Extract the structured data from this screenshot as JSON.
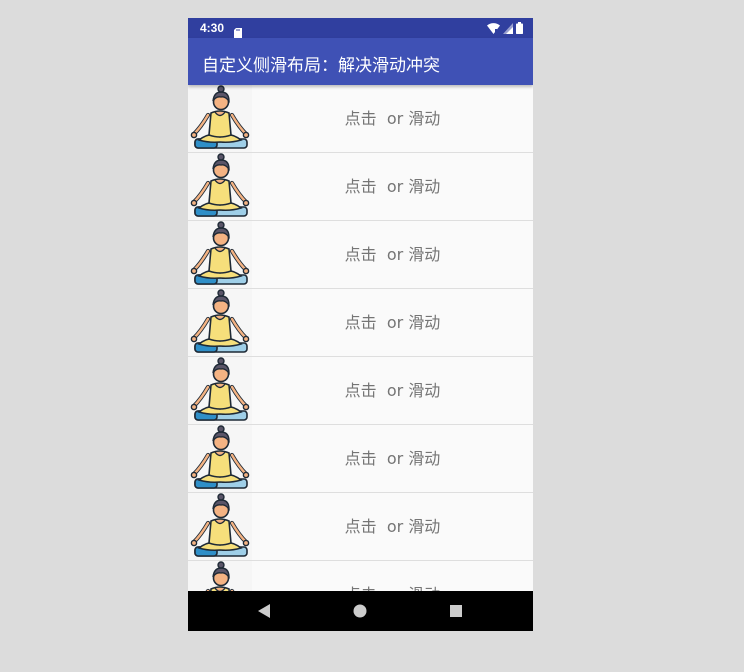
{
  "status_bar": {
    "time": "4:30",
    "icons": [
      "sd-card-icon",
      "wifi-icon",
      "cell-signal-icon",
      "battery-icon"
    ]
  },
  "app_bar": {
    "title": "自定义侧滑布局：解决滑动冲突"
  },
  "list": {
    "items": [
      {
        "label": "点击  or 滑动",
        "icon": "meditation-icon"
      },
      {
        "label": "点击  or 滑动",
        "icon": "meditation-icon"
      },
      {
        "label": "点击  or 滑动",
        "icon": "meditation-icon"
      },
      {
        "label": "点击  or 滑动",
        "icon": "meditation-icon"
      },
      {
        "label": "点击  or 滑动",
        "icon": "meditation-icon"
      },
      {
        "label": "点击  or 滑动",
        "icon": "meditation-icon"
      },
      {
        "label": "点击  or 滑动",
        "icon": "meditation-icon"
      },
      {
        "label": "点击  or 滑动",
        "icon": "meditation-icon"
      }
    ]
  },
  "nav_bar": {
    "buttons": [
      "back-icon",
      "home-icon",
      "recents-icon"
    ]
  },
  "colors": {
    "status_bar": "#303f9f",
    "app_bar": "#3f51b5",
    "nav_bar": "#000000",
    "list_background": "#fafafa",
    "row_text": "#757575"
  }
}
